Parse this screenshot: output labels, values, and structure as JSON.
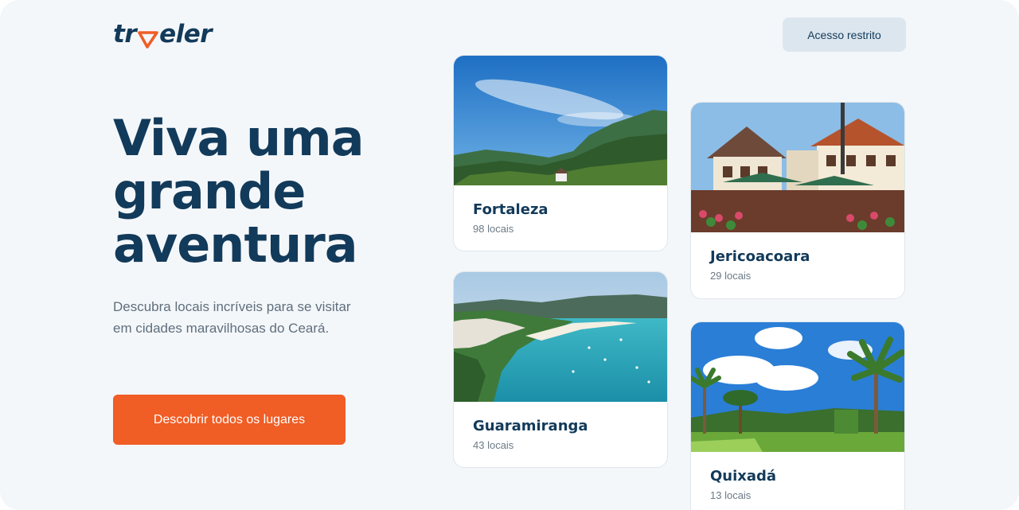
{
  "header": {
    "logo_text_before": "tr",
    "logo_text_after": "eler",
    "access_button_label": "Acesso restrito"
  },
  "hero": {
    "title_line1": "Viva uma",
    "title_line2": "grande",
    "title_line3": "aventura",
    "subtitle": "Descubra locais incríveis para se visitar em cidades maravilhosas do Ceará.",
    "cta_label": "Descobrir todos os lugares"
  },
  "colors": {
    "brand_navy": "#123a5a",
    "accent_orange": "#f05d25",
    "background": "#f4f7fa"
  },
  "cities": [
    {
      "name": "Fortaleza",
      "count": "98 locais",
      "image": "mountain-sea-photo"
    },
    {
      "name": "Guaramiranga",
      "count": "43 locais",
      "image": "coastal-bay-photo"
    },
    {
      "name": "Jericoacoara",
      "count": "29 locais",
      "image": "village-houses-photo"
    },
    {
      "name": "Quixadá",
      "count": "13 locais",
      "image": "palm-garden-photo"
    }
  ]
}
